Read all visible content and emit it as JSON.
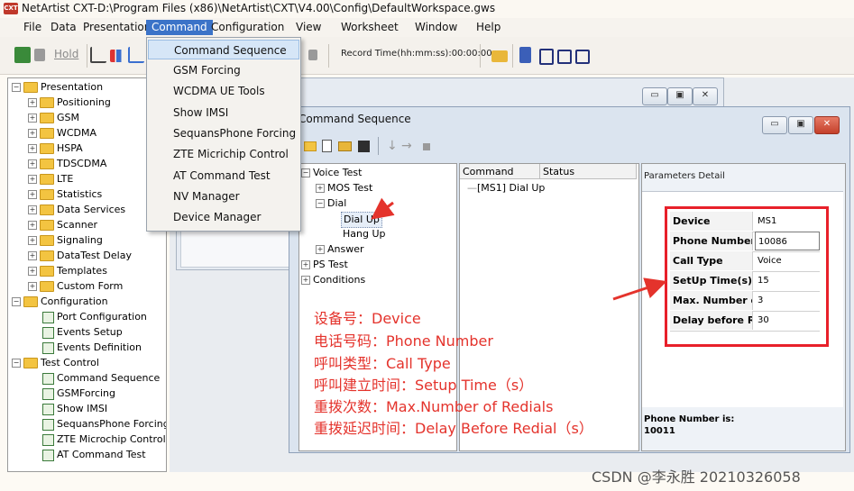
{
  "window": {
    "app_icon_text": "CXT",
    "title": "NetArtist CXT-D:\\Program Files (x86)\\NetArtist\\CXT\\V4.00\\Config\\DefaultWorkspace.gws"
  },
  "menubar": {
    "items": [
      "File",
      "Data",
      "Presentation",
      "Command",
      "Configuration",
      "View",
      "Worksheet",
      "Window",
      "Help"
    ]
  },
  "toolbar": {
    "hold_label": "Hold",
    "record_time": "Record Time(hh:mm:ss):00:00:00"
  },
  "command_menu": {
    "items": [
      "Command Sequence",
      "GSM Forcing",
      "WCDMA UE Tools",
      "Show IMSI",
      "SequansPhone Forcing",
      "ZTE Micrichip Control",
      "AT Command Test",
      "NV Manager",
      "Device Manager"
    ]
  },
  "left_tree": {
    "presentation": "Presentation",
    "presentation_children": [
      "Positioning",
      "GSM",
      "WCDMA",
      "HSPA",
      "TDSCDMA",
      "LTE",
      "Statistics",
      "Data Services",
      "Scanner",
      "Signaling",
      "DataTest Delay",
      "Templates",
      "Custom Form"
    ],
    "configuration": "Configuration",
    "configuration_children": [
      "Port Configuration",
      "Events Setup",
      "Events Definition"
    ],
    "test_control": "Test Control",
    "test_control_children": [
      "Command Sequence",
      "GSMForcing",
      "Show IMSI",
      "SequansPhone Forcing",
      "ZTE Microchip Control",
      "AT Command Test"
    ]
  },
  "cmd_window": {
    "title": "Command Sequence",
    "tree": {
      "voice_test": "Voice Test",
      "mos_test": "MOS Test",
      "dial": "Dial",
      "dial_up": "Dial Up",
      "hang_up": "Hang Up",
      "answer": "Answer",
      "ps_test": "PS Test",
      "conditions": "Conditions"
    },
    "list": {
      "col_command": "Command",
      "col_status": "Status",
      "row1": "[MS1] Dial Up"
    },
    "params": {
      "header": "Parameters Detail",
      "rows": [
        {
          "label": "Device",
          "value": "MS1"
        },
        {
          "label": "Phone Number",
          "value": "10086"
        },
        {
          "label": "Call Type",
          "value": "Voice"
        },
        {
          "label": "SetUp Time(s)",
          "value": "15"
        },
        {
          "label": "Max. Number of Re",
          "value": "3"
        },
        {
          "label": "Delay before Redi",
          "value": "30"
        }
      ],
      "footer_label": "Phone Number is:",
      "footer_value": "10011"
    }
  },
  "annotations": [
    "设备号：Device",
    "电话号码：Phone Number",
    "呼叫类型：Call Type",
    "呼叫建立时间：Setup Time（s）",
    "重拨次数：Max.Number of Redials",
    "重拨延迟时间：Delay Before Redial（s）"
  ],
  "watermark": "CSDN @李永胜 20210326058",
  "colors": {
    "menu_highlight": "#3b73c8",
    "annotation_red": "#e4332c"
  }
}
